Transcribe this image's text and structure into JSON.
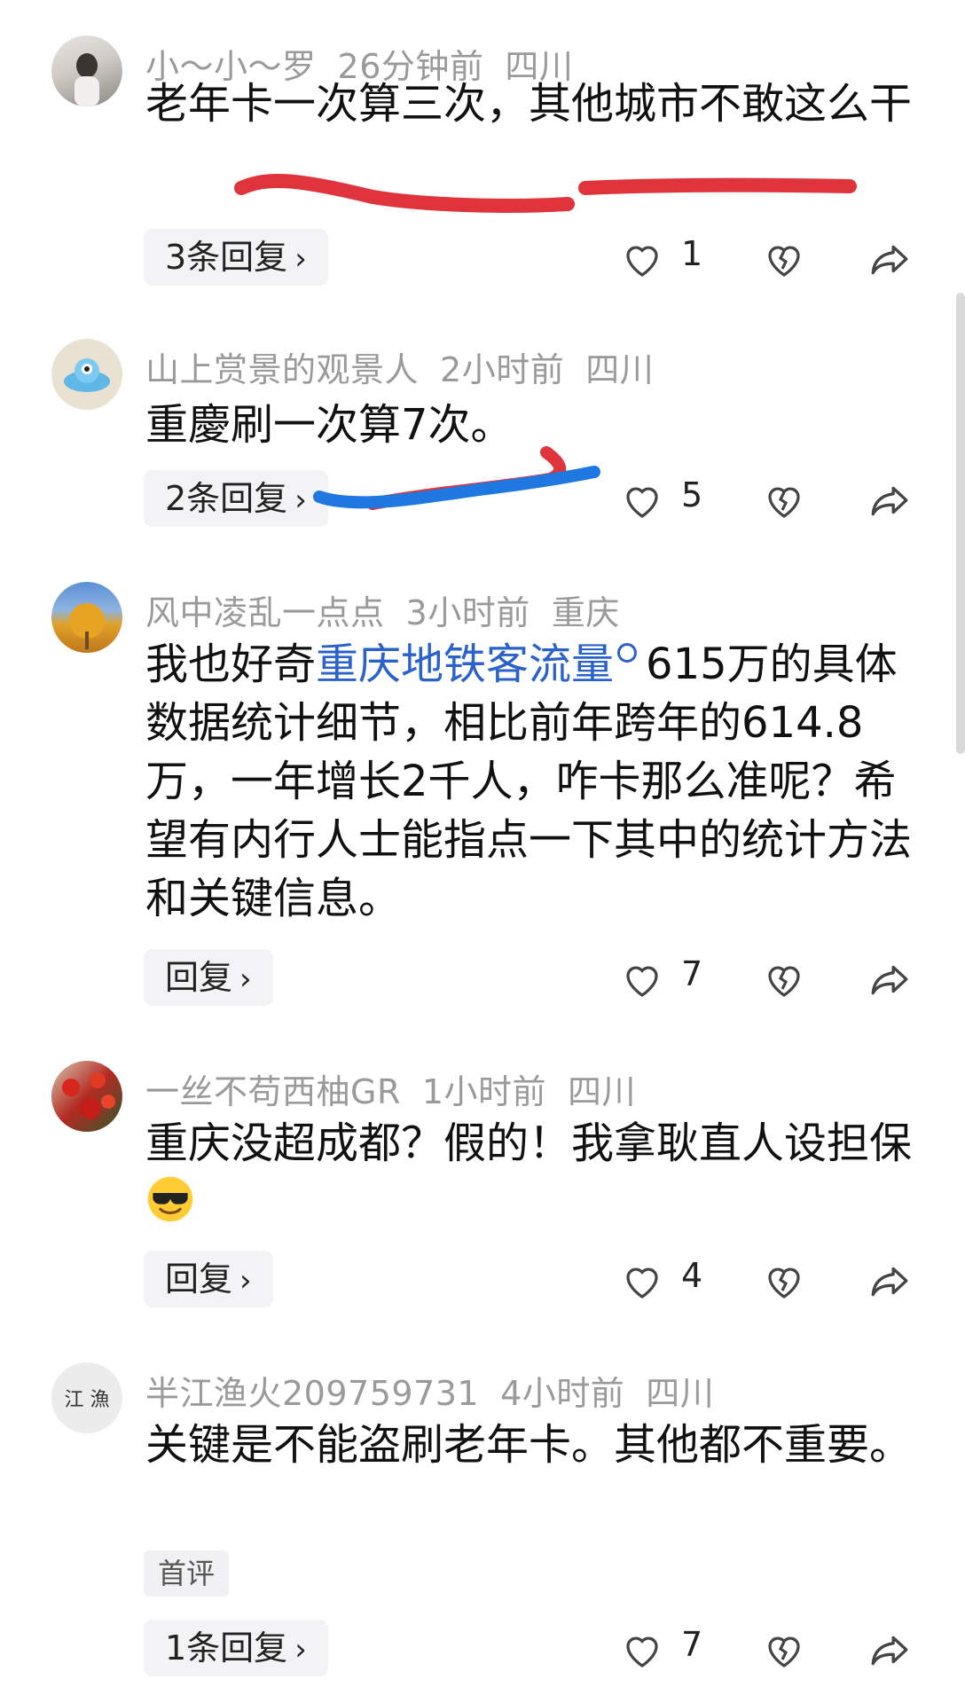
{
  "colors": {
    "accent_link": "#2b62c9",
    "annotation_red": "#e0343c",
    "annotation_blue": "#1e78e0",
    "meta_gray": "#9a9a9a",
    "pill_bg": "#f3f3f5"
  },
  "icons": {
    "like": "heart-outline-icon",
    "dislike": "broken-heart-icon",
    "share": "share-arrow-icon",
    "chevron": "chevron-right-icon",
    "search": "search-icon"
  },
  "comments": [
    {
      "username": "小～小～罗",
      "time": "26分钟前",
      "location": "四川",
      "text": "老年卡一次算三次，其他城市不敢这么干",
      "reply_label": "3条回复",
      "likes": "1"
    },
    {
      "username": "山上赏景的观景人",
      "time": "2小时前",
      "location": "四川",
      "text": "重慶刷一次算7次。",
      "reply_label": "2条回复",
      "likes": "5"
    },
    {
      "username": "风中凌乱一点点",
      "time": "3小时前",
      "location": "重庆",
      "text_before": "我也好奇",
      "link_text": "重庆地铁客流量",
      "text_after": "615万的具体数据统计细节，相比前年跨年的614.8万，一年增长2千人，咋卡那么准呢？希望有内行人士能指点一下其中的统计方法和关键信息。",
      "reply_label": "回复",
      "likes": "7"
    },
    {
      "username": "一丝不苟西柚GR",
      "time": "1小时前",
      "location": "四川",
      "text": "重庆没超成都？假的！我拿耿直人设担保",
      "reply_label": "回复",
      "likes": "4"
    },
    {
      "username": "半江渔火209759731",
      "time": "4小时前",
      "location": "四川",
      "avatar_text": "江 漁",
      "text": "关键是不能盗刷老年卡。其他都不重要。",
      "badge": "首评",
      "reply_label": "1条回复",
      "likes": "7"
    }
  ]
}
